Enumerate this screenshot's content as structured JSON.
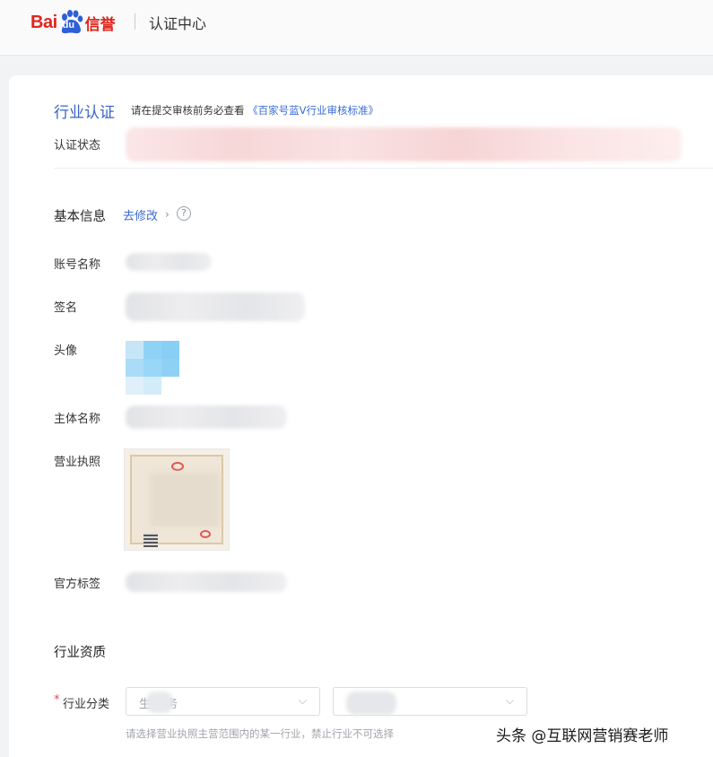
{
  "header": {
    "logo_text_1": "Bai",
    "logo_text_2": "du",
    "logo_text_3": "信誉",
    "title": "认证中心"
  },
  "industry_cert": {
    "title": "行业认证",
    "tip_prefix": "请在提交审核前务必查看",
    "tip_link": "《百家号蓝V行业审核标准》",
    "status_label": "认证状态"
  },
  "basic_info": {
    "title": "基本信息",
    "edit_link": "去修改",
    "chevron": "›",
    "help": "?",
    "rows": {
      "account_name": "账号名称",
      "signature": "签名",
      "avatar": "头像",
      "entity_name": "主体名称",
      "business_license": "营业执照",
      "official_tag": "官方标签"
    }
  },
  "industry_qualification": {
    "title": "行业资质",
    "required_mark": "*",
    "category_label": "行业分类",
    "select_primary_value": "生      服务",
    "select_secondary_value": "",
    "hint": "请选择营业执照主营范围内的某一行业，禁止行业不可选择"
  },
  "watermark": "头条 @互联网营销赛老师",
  "colors": {
    "accent_blue": "#3864c8",
    "link_blue": "#3a6bd6",
    "brand_red": "#e1251b",
    "required_red": "#e24a4a"
  }
}
